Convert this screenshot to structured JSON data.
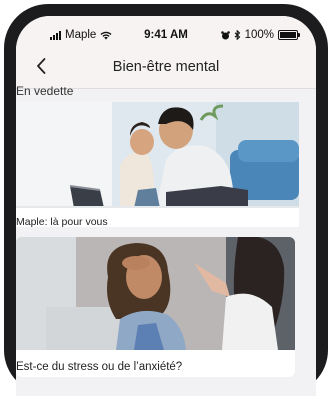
{
  "status_bar": {
    "carrier": "Maple",
    "time": "9:41 AM",
    "battery": "100%"
  },
  "nav": {
    "title": "Bien-être mental"
  },
  "section": {
    "label": "En vedette"
  },
  "cards": [
    {
      "caption": "Maple: là pour vous"
    },
    {
      "caption": "Est-ce du stress ou de l’anxiété?"
    }
  ]
}
